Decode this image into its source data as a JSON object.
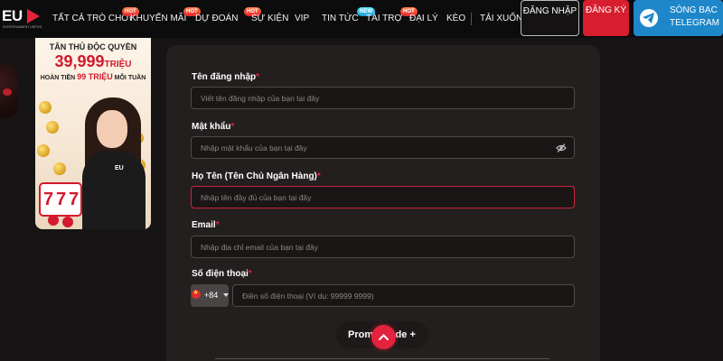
{
  "logo": {
    "text": "EU",
    "tagline": "ENTERTAINMENT UNITED"
  },
  "nav": {
    "items": [
      {
        "label": "TẤT CẢ TRÒ CHƠI",
        "badge": ""
      },
      {
        "label": "KHUYẾN MÃI",
        "badge": "HOT"
      },
      {
        "label": "DỰ ĐOÁN",
        "badge": "HOT"
      },
      {
        "label": "SỰ KIỆN",
        "badge": "HOT"
      },
      {
        "label": "VIP",
        "badge": ""
      },
      {
        "label": "TIN TỨC",
        "badge": "NEW"
      },
      {
        "label": "TÀI TRỢ",
        "badge": "HOT"
      },
      {
        "label": "ĐẠI LÝ",
        "badge": "HOT"
      },
      {
        "label": "KÈO",
        "badge": ""
      },
      {
        "label": "TẢI XUỐNG",
        "badge": ""
      }
    ],
    "login": "ĐĂNG NHẬP",
    "register": "ĐĂNG KÝ",
    "telegram": "SÒNG BẠC TELEGRAM"
  },
  "banner": {
    "line1": "TÂN THỦ ĐỘC QUYỀN",
    "amount": "39,999",
    "amount_unit": "TRIỆU",
    "line3_prefix": "HOÀN TIỀN",
    "line3_highlight": "99 TRIỆU",
    "line3_suffix": "MỖI TUẦN",
    "slot_digits": [
      "7",
      "7",
      "7"
    ],
    "shirt_logo": "EU"
  },
  "form": {
    "username": {
      "label": "Tên đăng nhập",
      "placeholder": "Viết tên đăng nhập của bạn tại đây",
      "value": ""
    },
    "password": {
      "label": "Mật khẩu",
      "placeholder": "Nhập mật khẩu của bạn tại đây",
      "value": ""
    },
    "fullname": {
      "label": "Họ Tên (Tên Chủ Ngân Hàng)",
      "placeholder": "Nhập tên đầy đủ của bạn tại đây",
      "value": ""
    },
    "email": {
      "label": "Email",
      "placeholder": "Nhập địa chỉ email của bạn tại đây",
      "value": ""
    },
    "phone": {
      "label": "Số điện thoại",
      "placeholder": "Điền số điện thoại (Ví dụ: 99999 9999)",
      "value": "",
      "dial_code": "+84"
    },
    "required_mark": "*",
    "promo_label": "Promo Code +"
  },
  "colors": {
    "accent": "#e3223c",
    "panel": "#241f1f",
    "telegram": "#1e87c9"
  },
  "icons": {
    "scroll_top": "chevron-up-icon",
    "password_toggle": "eye-slash-icon",
    "telegram": "telegram-plane-icon"
  }
}
